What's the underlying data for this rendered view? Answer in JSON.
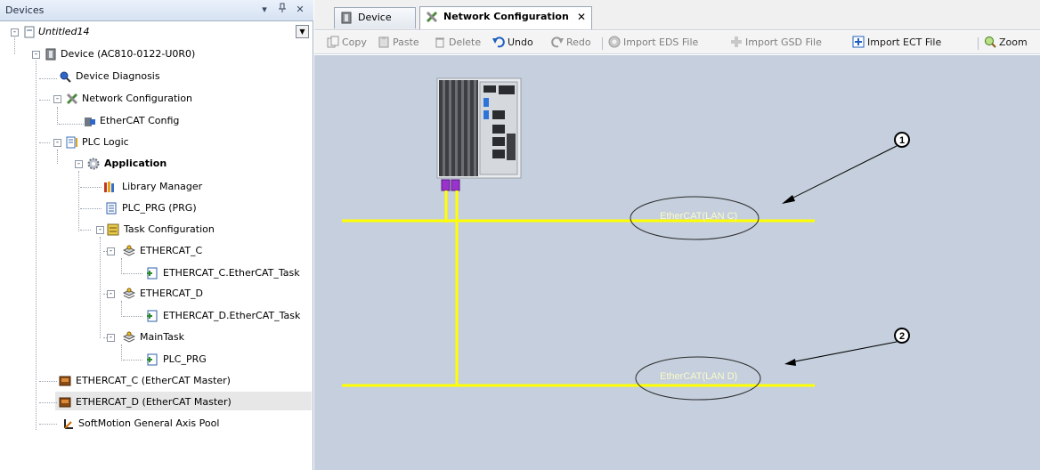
{
  "devices_panel": {
    "title": "Devices",
    "pin_glyph": "▾",
    "dock_glyph": "ᵽ",
    "close_glyph": "✕"
  },
  "tree": {
    "project": "Untitled14",
    "device": "Device (AC810-0122-U0R0)",
    "device_diagnosis": "Device Diagnosis",
    "network_configuration": "Network Configuration",
    "ethercat_config": "EtherCAT Config",
    "plc_logic": "PLC Logic",
    "application": "Application",
    "library_manager": "Library Manager",
    "plc_prg": "PLC_PRG (PRG)",
    "task_configuration": "Task Configuration",
    "ethercat_c_task": "ETHERCAT_C",
    "ethercat_c_task_call": "ETHERCAT_C.EtherCAT_Task",
    "ethercat_d_task": "ETHERCAT_D",
    "ethercat_d_task_call": "ETHERCAT_D.EtherCAT_Task",
    "main_task": "MainTask",
    "main_task_call": "PLC_PRG",
    "ethercat_c_master": "ETHERCAT_C (EtherCAT Master)",
    "ethercat_d_master": "ETHERCAT_D (EtherCAT Master)",
    "softmotion_pool": "SoftMotion General Axis Pool"
  },
  "tabs": [
    {
      "label": "Device",
      "active": false
    },
    {
      "label": "Network Configuration",
      "active": true,
      "close": "✕"
    }
  ],
  "toolbar": {
    "copy": "Copy",
    "paste": "Paste",
    "delete": "Delete",
    "undo": "Undo",
    "redo": "Redo",
    "import_eds": "Import EDS File",
    "import_gsd": "Import GSD File",
    "import_ect": "Import ECT File",
    "zoom": "Zoom"
  },
  "diagram": {
    "bus_c_label": "EtherCAT(LAN C)",
    "bus_d_label": "EtherCAT(LAN D)",
    "callout_1": "1",
    "callout_2": "2",
    "bus_color": "#ffff00",
    "port_color": "#9933cc",
    "canvas_color": "#c5cfdd"
  },
  "colors": {
    "panel_title_bg": "#dbe5f3",
    "selected_row_bg": "#e7e7e7"
  }
}
